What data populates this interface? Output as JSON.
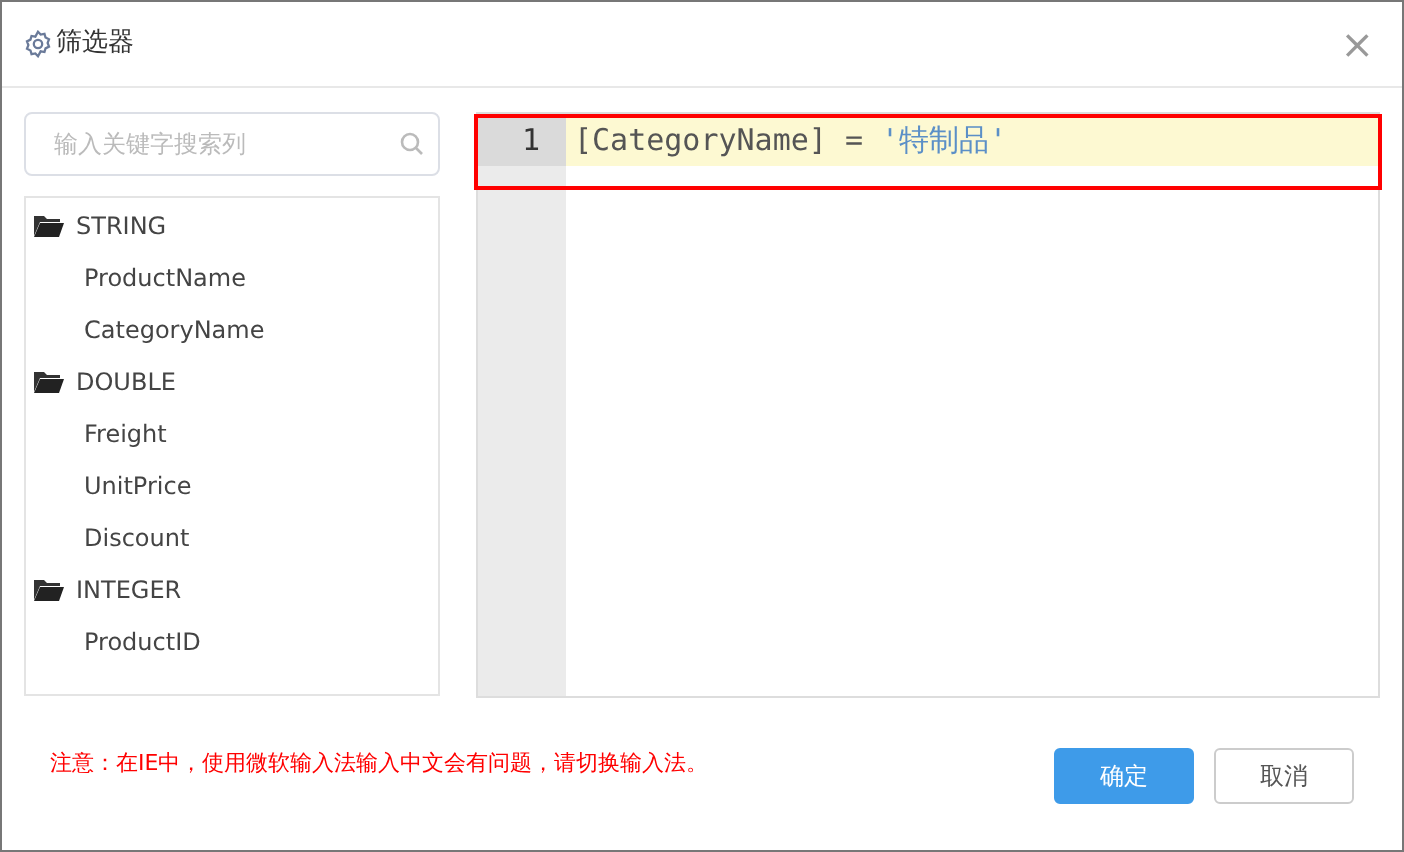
{
  "window": {
    "title": "筛选器",
    "close": "×"
  },
  "search": {
    "placeholder": "输入关键字搜索列"
  },
  "tree": [
    {
      "label": "STRING",
      "children": [
        {
          "label": "ProductName"
        },
        {
          "label": "CategoryName"
        }
      ]
    },
    {
      "label": "DOUBLE",
      "children": [
        {
          "label": "Freight"
        },
        {
          "label": "UnitPrice"
        },
        {
          "label": "Discount"
        }
      ]
    },
    {
      "label": "INTEGER",
      "children": [
        {
          "label": "ProductID"
        }
      ]
    }
  ],
  "editor": {
    "lines": [
      {
        "number": "1",
        "current": true,
        "tokens": [
          {
            "kind": "plain",
            "text": "[CategoryName] = "
          },
          {
            "kind": "string",
            "text": "'特制品'"
          }
        ]
      }
    ],
    "highlight_frame": true
  },
  "note": "注意：在IE中，使用微软输入法输入中文会有问题，请切换输入法。",
  "buttons": [
    {
      "label": "确定",
      "kind": "primary"
    },
    {
      "label": "取消",
      "kind": "secondary"
    }
  ]
}
